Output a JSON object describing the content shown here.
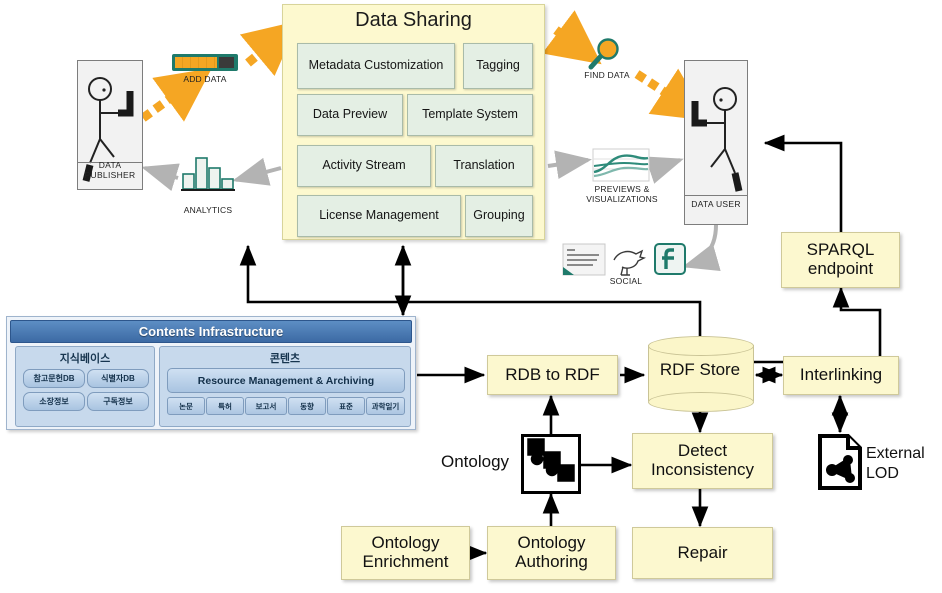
{
  "data_sharing": {
    "title": "Data Sharing",
    "features": [
      {
        "label": "Metadata Customization"
      },
      {
        "label": "Tagging"
      },
      {
        "label": "Data Preview"
      },
      {
        "label": "Template System"
      },
      {
        "label": "Activity Stream"
      },
      {
        "label": "Translation"
      },
      {
        "label": "License Management"
      },
      {
        "label": "Grouping"
      }
    ]
  },
  "actors": {
    "publisher": "DATA\nPUBLISHER",
    "publisher_line1": "DATA",
    "publisher_line2": "PUBLISHER",
    "user": "DATA USER"
  },
  "captions": {
    "add_data": "ADD DATA",
    "find_data": "FIND DATA",
    "analytics": "ANALYTICS",
    "previews_line1": "PREVIEWS &",
    "previews_line2": "VISUALIZATIONS",
    "social": "SOCIAL"
  },
  "contents_infrastructure": {
    "header": "Contents Infrastructure",
    "knowledge_base": {
      "title": "지식베이스",
      "items": [
        "참고문헌DB",
        "식별자DB",
        "소장정보",
        "구독정보"
      ]
    },
    "contents": {
      "title": "콘텐츠",
      "main": "Resource Management & Archiving",
      "tags": [
        "논문",
        "특허",
        "보고서",
        "동향",
        "표준",
        "과학일기"
      ]
    }
  },
  "pipeline": {
    "rdb_to_rdf": "RDB to RDF",
    "rdf_store": "RDF Store",
    "interlinking": "Interlinking",
    "sparql_line1": "SPARQL",
    "sparql_line2": "endpoint",
    "detect_line1": "Detect",
    "detect_line2": "Inconsistency",
    "repair": "Repair",
    "ontology_label": "Ontology",
    "ontology_enrichment_line1": "Ontology",
    "ontology_enrichment_line2": "Enrichment",
    "ontology_authoring_line1": "Ontology",
    "ontology_authoring_line2": "Authoring",
    "external_lod_line1": "External",
    "external_lod_line2": "LOD"
  },
  "colors": {
    "panel_yellow": "#fdf9cf",
    "feature_green": "#e4efe4",
    "box_yellow": "#fcf8cf",
    "header_blue": "#3c6aa4",
    "pill_blue": "#a9c4e1",
    "orange_arrow": "#f5a623",
    "gray_arrow": "#b3b3b3",
    "teal": "#1f7a6b"
  }
}
